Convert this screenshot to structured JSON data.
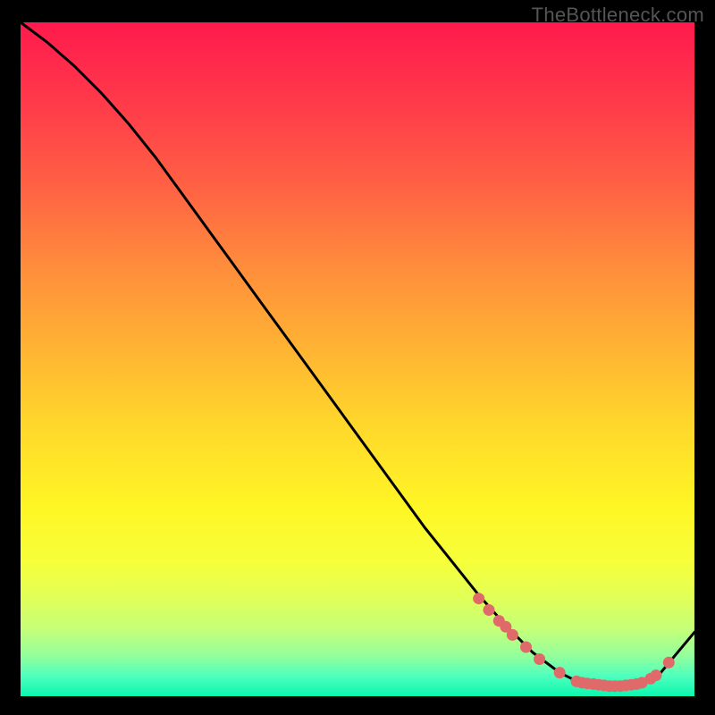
{
  "watermark": "TheBottleneck.com",
  "colors": {
    "page_bg": "#000000",
    "curve": "#000000",
    "marker": "#e06a6a"
  },
  "chart_data": {
    "type": "line",
    "title": "",
    "xlabel": "",
    "ylabel": "",
    "xlim": [
      0,
      100
    ],
    "ylim": [
      0,
      100
    ],
    "series": [
      {
        "name": "curve",
        "x": [
          0,
          4,
          8,
          12,
          16,
          20,
          24,
          28,
          32,
          36,
          40,
          44,
          48,
          52,
          56,
          60,
          64,
          68,
          72,
          76,
          80,
          83,
          86,
          89,
          92,
          95,
          100
        ],
        "y": [
          100,
          97,
          93.5,
          89.5,
          85,
          80,
          74.5,
          69,
          63.5,
          58,
          52.5,
          47,
          41.5,
          36,
          30.5,
          25,
          20,
          15,
          10.5,
          6.5,
          3.5,
          2,
          1.5,
          1.5,
          2,
          3.5,
          9.5
        ]
      }
    ],
    "markers": {
      "comment": "marker (x,y) points along the curve near the trough",
      "points": [
        [
          68.0,
          14.5
        ],
        [
          69.5,
          12.8
        ],
        [
          71.0,
          11.2
        ],
        [
          72.0,
          10.3
        ],
        [
          73.0,
          9.1
        ],
        [
          75.0,
          7.3
        ],
        [
          77.0,
          5.5
        ],
        [
          80.0,
          3.5
        ],
        [
          82.5,
          2.2
        ],
        [
          83.3,
          2.0
        ],
        [
          84.1,
          1.9
        ],
        [
          85.0,
          1.8
        ],
        [
          85.8,
          1.7
        ],
        [
          86.6,
          1.6
        ],
        [
          87.4,
          1.5
        ],
        [
          88.2,
          1.5
        ],
        [
          89.0,
          1.5
        ],
        [
          89.8,
          1.6
        ],
        [
          90.6,
          1.7
        ],
        [
          91.4,
          1.8
        ],
        [
          92.2,
          2.0
        ],
        [
          93.5,
          2.6
        ],
        [
          94.3,
          3.1
        ],
        [
          96.2,
          5.0
        ]
      ],
      "r": 6.5
    }
  }
}
